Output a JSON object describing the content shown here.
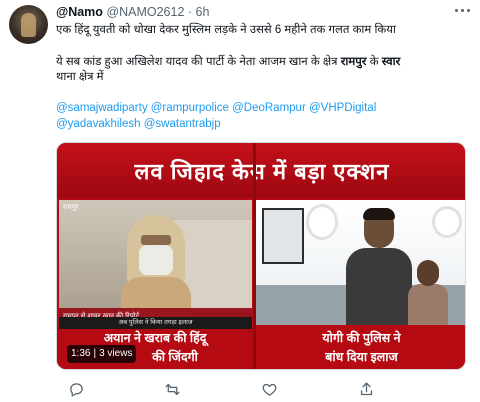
{
  "tweet": {
    "display_name": "@Namo",
    "handle": "@NAMO2612",
    "separator": "·",
    "time": "6h",
    "line1": "एक हिंदू युवती को धोखा देकर मुस्लिम लड़के ने उससे 6 महीने तक गलत काम किया",
    "line2_pre": "ये सब कांड हुआ अखिलेश यादव की पार्टी के नेता आजम खान के क्षेत्र ",
    "line2_bold1": "रामपुर",
    "line2_mid": " के ",
    "line2_bold2": "स्वार",
    "line3": "थाना क्षेत्र में",
    "hashtags_line1": "@samajwadiparty @rampurpolice @DeoRampur @VHPDigital",
    "hashtags_line2": "@yadavakhilesh @swatantrabjp"
  },
  "video": {
    "banner": "लव जिहाद केस में बड़ा एक्शन",
    "location_tag": "रामपुर",
    "left_caption": "रामपुर से शावर खान की रिपोर्ट",
    "left_subcaption": "अब पुलिस ने किया तगड़ा इलाज",
    "left_strip_line1": "अयान ने खराब की हिंदू",
    "left_strip_line2": "की जिंदगी",
    "right_strip_line1": "योगी की पुलिस ने",
    "right_strip_line2": "बांध दिया इलाज",
    "duration": "1:36",
    "views": "3 views"
  },
  "icons": [
    "more-icon",
    "reply-icon",
    "retweet-icon",
    "like-icon",
    "share-icon"
  ],
  "colors": {
    "link": "#1d9bf0",
    "secondary": "#536471",
    "banner_red": "#b50a12"
  }
}
